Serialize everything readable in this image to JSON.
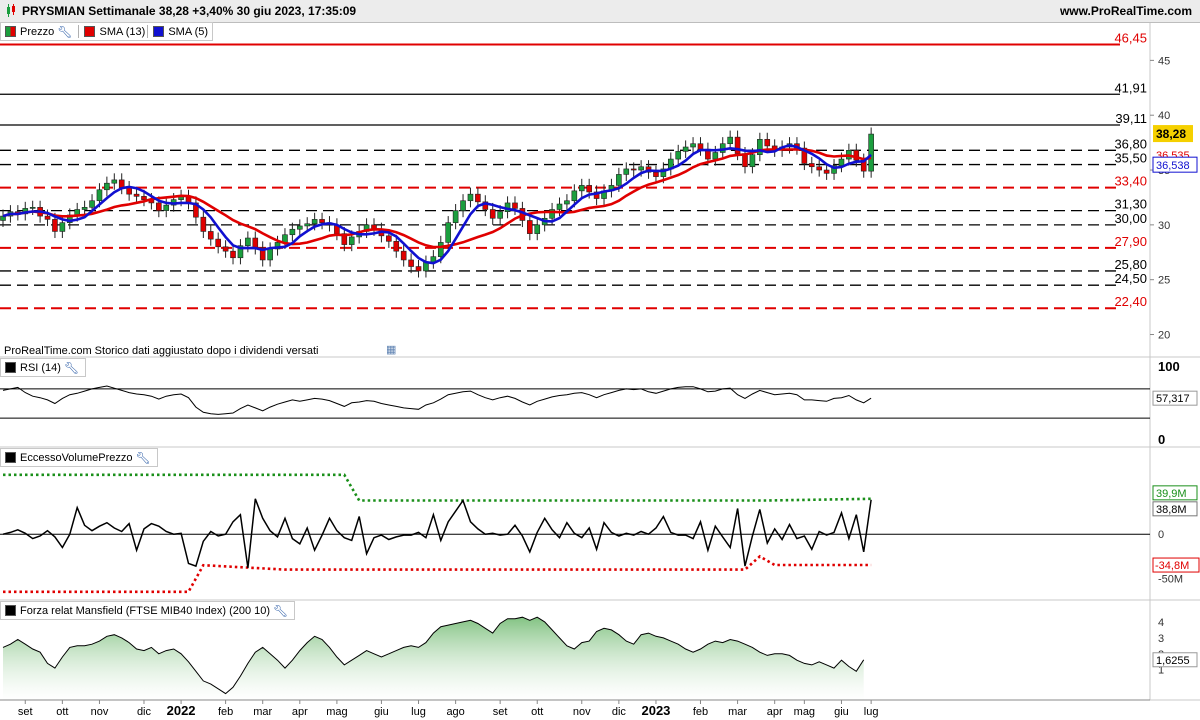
{
  "header": {
    "title": "PRYSMIAN Settimanale 38,28 +3,40% 30 giu 2023, 17:35:09",
    "site": "www.ProRealTime.com"
  },
  "price_panel": {
    "legend": [
      {
        "label": "Prezzo",
        "color": "#1b9e3e"
      },
      {
        "label": "SMA (13)",
        "color": "#e00000"
      },
      {
        "label": "SMA (5)",
        "color": "#1010d0"
      }
    ],
    "note": "ProRealTime.com Storico dati aggiustato dopo i dividendi versati"
  },
  "rsi_panel": {
    "legend": "RSI (14)"
  },
  "volume_panel": {
    "legend": "EccessoVolumePrezzo"
  },
  "mansfield_panel": {
    "legend": "Forza relat Mansfield (FTSE MIB40 Index) (200 10)"
  },
  "chart_data": [
    {
      "type": "candlestick",
      "title": "PRYSMIAN Settimanale",
      "ylim": [
        19.5,
        48.5
      ],
      "yticks": [
        "45",
        "40",
        "35",
        "30",
        "25",
        "20"
      ],
      "last_price": "38,28",
      "last_price_color": "#f5d000",
      "sma13_label": "36,535",
      "sma5_label": "36,538",
      "levels": [
        {
          "value": 46.45,
          "label": "46,45",
          "style": "solid",
          "color": "#e00000"
        },
        {
          "value": 41.91,
          "label": "41,91",
          "style": "solid",
          "color": "#000000"
        },
        {
          "value": 39.11,
          "label": "39,11",
          "style": "solid",
          "color": "#000000"
        },
        {
          "value": 36.8,
          "label": "36,80",
          "style": "dashed",
          "color": "#000000"
        },
        {
          "value": 35.5,
          "label": "35,50",
          "style": "dashed",
          "color": "#000000"
        },
        {
          "value": 33.4,
          "label": "33,40",
          "style": "dashed",
          "color": "#e00000"
        },
        {
          "value": 31.3,
          "label": "31,30",
          "style": "dashed",
          "color": "#000000"
        },
        {
          "value": 30.0,
          "label": "30,00",
          "style": "dashed",
          "color": "#000000"
        },
        {
          "value": 27.9,
          "label": "27,90",
          "style": "dashed",
          "color": "#e00000"
        },
        {
          "value": 25.8,
          "label": "25,80",
          "style": "dashed",
          "color": "#000000"
        },
        {
          "value": 24.5,
          "label": "24,50",
          "style": "dashed",
          "color": "#000000"
        },
        {
          "value": 22.4,
          "label": "22,40",
          "style": "dashed",
          "color": "#e00000"
        }
      ],
      "xlabels": [
        {
          "label": "set",
          "week": 3,
          "bold": false
        },
        {
          "label": "ott",
          "week": 8,
          "bold": false
        },
        {
          "label": "nov",
          "week": 13,
          "bold": false
        },
        {
          "label": "dic",
          "week": 19,
          "bold": false
        },
        {
          "label": "2022",
          "week": 24,
          "bold": true
        },
        {
          "label": "feb",
          "week": 30,
          "bold": false
        },
        {
          "label": "mar",
          "week": 35,
          "bold": false
        },
        {
          "label": "apr",
          "week": 40,
          "bold": false
        },
        {
          "label": "mag",
          "week": 45,
          "bold": false
        },
        {
          "label": "giu",
          "week": 51,
          "bold": false
        },
        {
          "label": "lug",
          "week": 56,
          "bold": false
        },
        {
          "label": "ago",
          "week": 61,
          "bold": false
        },
        {
          "label": "set",
          "week": 67,
          "bold": false
        },
        {
          "label": "ott",
          "week": 72,
          "bold": false
        },
        {
          "label": "nov",
          "week": 78,
          "bold": false
        },
        {
          "label": "dic",
          "week": 83,
          "bold": false
        },
        {
          "label": "2023",
          "week": 88,
          "bold": true
        },
        {
          "label": "feb",
          "week": 94,
          "bold": false
        },
        {
          "label": "mar",
          "week": 99,
          "bold": false
        },
        {
          "label": "apr",
          "week": 104,
          "bold": false
        },
        {
          "label": "mag",
          "week": 108,
          "bold": false
        },
        {
          "label": "giu",
          "week": 113,
          "bold": false
        },
        {
          "label": "lug",
          "week": 117,
          "bold": false
        }
      ],
      "closes": [
        30.8,
        31.2,
        31.0,
        31.5,
        31.6,
        30.8,
        30.5,
        29.4,
        30.2,
        30.9,
        31.4,
        31.6,
        32.2,
        33.2,
        33.8,
        34.1,
        33.4,
        32.8,
        32.6,
        32.3,
        32.0,
        31.3,
        31.8,
        32.3,
        32.6,
        32.0,
        30.7,
        29.4,
        28.7,
        28.0,
        27.6,
        27.0,
        28.1,
        28.8,
        27.9,
        26.8,
        27.8,
        28.4,
        29.1,
        29.6,
        29.9,
        30.1,
        30.5,
        30.2,
        30.0,
        29.2,
        28.2,
        28.9,
        29.4,
        30.0,
        29.6,
        29.0,
        28.5,
        27.6,
        26.8,
        26.2,
        25.8,
        26.6,
        27.1,
        28.4,
        30.2,
        31.3,
        32.2,
        32.8,
        32.1,
        31.4,
        30.6,
        31.2,
        32.0,
        31.5,
        30.4,
        29.2,
        30.0,
        30.6,
        31.4,
        31.9,
        32.2,
        33.1,
        33.6,
        33.0,
        32.4,
        33.1,
        33.6,
        34.6,
        35.1,
        35.0,
        35.3,
        34.8,
        34.4,
        35.1,
        36.0,
        36.7,
        37.1,
        37.4,
        36.9,
        36.0,
        36.6,
        37.4,
        38.0,
        36.5,
        35.3,
        36.4,
        37.8,
        37.2,
        36.8,
        37.1,
        37.4,
        37.0,
        35.6,
        35.3,
        35.0,
        34.7,
        35.4,
        36.0,
        36.8,
        35.9,
        34.9,
        38.28
      ]
    },
    {
      "type": "line",
      "title": "RSI (14)",
      "ylim": [
        0,
        100
      ],
      "yticks": [
        "100",
        "0"
      ],
      "last_label": "57,317",
      "values": [
        68,
        70,
        72,
        65,
        60,
        58,
        55,
        50,
        57,
        62,
        64,
        67,
        70,
        72,
        74,
        71,
        68,
        65,
        63,
        62,
        60,
        56,
        60,
        62,
        63,
        58,
        45,
        38,
        36,
        35,
        36,
        37,
        43,
        48,
        44,
        40,
        45,
        49,
        52,
        55,
        53,
        55,
        57,
        56,
        54,
        50,
        46,
        51,
        52,
        54,
        53,
        50,
        48,
        46,
        44,
        43,
        42,
        48,
        51,
        56,
        62,
        64,
        66,
        67,
        62,
        58,
        55,
        58,
        60,
        57,
        52,
        48,
        53,
        56,
        59,
        61,
        62,
        64,
        65,
        62,
        58,
        62,
        65,
        68,
        70,
        69,
        70,
        66,
        64,
        67,
        70,
        72,
        73,
        73,
        70,
        66,
        67,
        70,
        71,
        62,
        57,
        63,
        68,
        65,
        62,
        63,
        64,
        62,
        55,
        55,
        54,
        53,
        57,
        58,
        61,
        55,
        51,
        57.3
      ]
    },
    {
      "type": "line",
      "title": "EccessoVolumePrezzo",
      "ylim": [
        -72,
        86
      ],
      "yticks": [
        "0",
        "-50M"
      ],
      "last_label": "38,8M",
      "upper_label": "39,9M",
      "lower_label": "-34,8M",
      "values": [
        0,
        2,
        5,
        1,
        -5,
        -2,
        4,
        -3,
        -15,
        0,
        30,
        10,
        4,
        9,
        13,
        7,
        3,
        12,
        -18,
        6,
        12,
        9,
        3,
        0,
        1,
        -33,
        -36,
        -8,
        3,
        -2,
        0,
        14,
        22,
        -38,
        40,
        18,
        4,
        -3,
        18,
        -5,
        -11,
        7,
        -18,
        -1,
        18,
        4,
        -4,
        -7,
        20,
        -22,
        -4,
        -1,
        -6,
        -3,
        -1,
        -1,
        2,
        -4,
        22,
        -7,
        14,
        26,
        38,
        14,
        6,
        0,
        1,
        -1,
        0,
        10,
        -2,
        -20,
        2,
        18,
        5,
        -4,
        13,
        1,
        -4,
        7,
        -17,
        13,
        2,
        -2,
        1,
        -1,
        3,
        0,
        7,
        20,
        2,
        -1,
        -1,
        -5,
        14,
        -18,
        9,
        -3,
        -15,
        29,
        -36,
        -2,
        28,
        -10,
        6,
        -6,
        11,
        -5,
        -2,
        -17,
        3,
        -1,
        2,
        24,
        -5,
        22,
        -20,
        38.8
      ],
      "upper_line": [
        [
          0,
          67
        ],
        [
          46,
          67
        ],
        [
          48,
          38
        ],
        [
          103,
          38
        ],
        [
          117,
          39.9
        ]
      ],
      "lower_line": [
        [
          0,
          -65
        ],
        [
          25,
          -65
        ],
        [
          27,
          -35
        ],
        [
          38,
          -40
        ],
        [
          100,
          -40
        ],
        [
          102,
          -25
        ],
        [
          104,
          -34.8
        ],
        [
          117,
          -34.8
        ]
      ]
    },
    {
      "type": "area",
      "title": "Forza relat Mansfield (FTSE MIB40 Index) (200 10)",
      "ylim": [
        -0.9,
        5
      ],
      "yticks": [
        "4",
        "3",
        "2",
        "1"
      ],
      "last_label": "1,6255",
      "values": [
        2.4,
        2.6,
        2.9,
        2.6,
        2.3,
        2.1,
        1.4,
        1.1,
        1.8,
        2.4,
        2.5,
        2.5,
        2.6,
        2.8,
        3.1,
        3.2,
        3.0,
        2.7,
        2.3,
        2.2,
        2.4,
        2.0,
        2.2,
        2.3,
        2.0,
        1.5,
        0.9,
        0.3,
        0.1,
        -0.2,
        -0.5,
        -0.1,
        0.6,
        1.4,
        2.1,
        2.4,
        2.0,
        1.6,
        1.1,
        1.6,
        2.2,
        2.7,
        3.1,
        2.9,
        2.4,
        1.8,
        1.3,
        1.6,
        1.9,
        2.2,
        2.0,
        1.8,
        2.0,
        2.2,
        2.4,
        2.5,
        2.4,
        2.7,
        3.3,
        3.7,
        3.8,
        3.9,
        4.0,
        4.1,
        3.9,
        3.6,
        3.3,
        3.9,
        4.2,
        4.2,
        4.3,
        4.1,
        4.3,
        4.0,
        3.5,
        3.0,
        2.5,
        2.3,
        2.7,
        2.8,
        3.4,
        3.6,
        3.5,
        3.2,
        2.8,
        2.6,
        3.2,
        3.3,
        3.1,
        3.0,
        2.8,
        2.6,
        2.3,
        2.1,
        2.3,
        2.6,
        2.8,
        2.7,
        2.9,
        2.8,
        2.6,
        2.4,
        2.1,
        1.9,
        2.0,
        2.0,
        1.9,
        1.6,
        1.4,
        1.3,
        1.5,
        1.3,
        1.1,
        1.6,
        1.2,
        0.9,
        1.6255
      ]
    }
  ]
}
